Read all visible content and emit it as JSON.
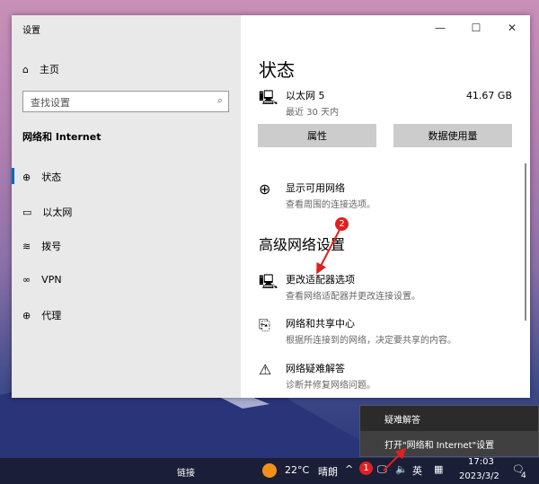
{
  "window": {
    "title": "设置",
    "minimize": "—",
    "maximize": "☐",
    "close": "✕"
  },
  "sidebar": {
    "home": "主页",
    "search_placeholder": "查找设置",
    "section": "网络和 Internet",
    "items": [
      {
        "label": "状态"
      },
      {
        "label": "以太网"
      },
      {
        "label": "拨号"
      },
      {
        "label": "VPN"
      },
      {
        "label": "代理"
      }
    ]
  },
  "main": {
    "title": "状态",
    "network_name": "以太网 5",
    "network_sub": "最近 30 天内",
    "usage": "41.67 GB",
    "btn_properties": "属性",
    "btn_usage": "数据使用量",
    "show_networks": {
      "title": "显示可用网络",
      "sub": "查看周围的连接选项。"
    },
    "advanced_title": "高级网络设置",
    "adapter": {
      "title": "更改适配器选项",
      "sub": "查看网络适配器并更改连接设置。"
    },
    "sharing": {
      "title": "网络和共享中心",
      "sub": "根据所连接到的网络，决定要共享的内容。"
    },
    "troubleshoot": {
      "title": "网络疑难解答",
      "sub": "诊断并修复网络问题。"
    }
  },
  "context_menu": {
    "items": [
      "疑难解答",
      "打开\"网络和 Internet\"设置"
    ]
  },
  "taskbar": {
    "link": "链接",
    "temp": "22°C",
    "weather": "晴朗",
    "lang": "英",
    "time": "17:03",
    "date": "2023/3/2",
    "notif_count": "4"
  },
  "annotations": {
    "step1": "1",
    "step2": "2"
  }
}
